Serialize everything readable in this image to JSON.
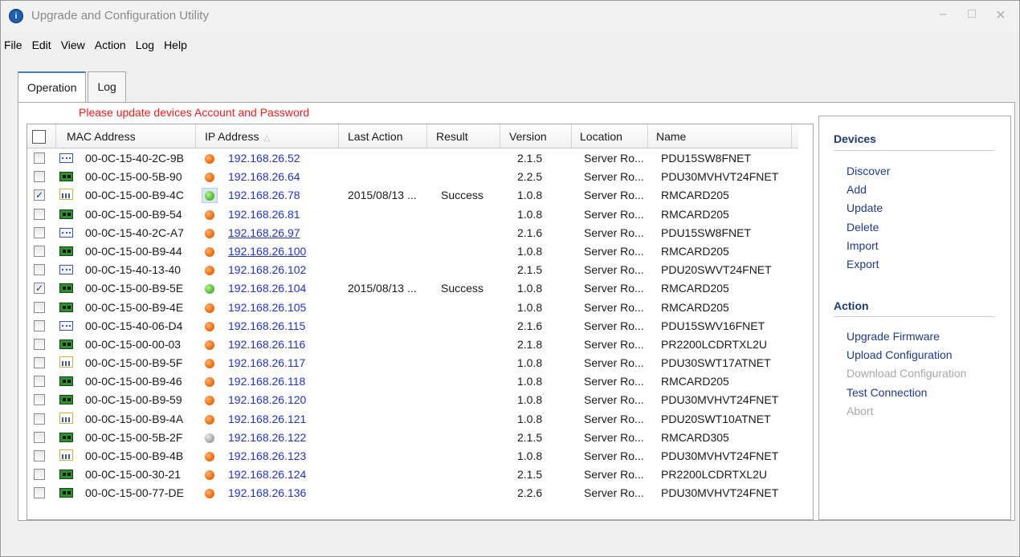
{
  "window": {
    "title": "Upgrade and Configuration Utility",
    "icon_name": "app-info-icon",
    "controls": [
      "minimize-icon",
      "maximize-icon",
      "close-icon"
    ]
  },
  "menu": [
    "File",
    "Edit",
    "View",
    "Action",
    "Log",
    "Help"
  ],
  "tabs": [
    {
      "label": "Operation",
      "active": true
    },
    {
      "label": "Log",
      "active": false
    }
  ],
  "warning": "Please update devices Account and Password",
  "table": {
    "columns": [
      "MAC Address",
      "IP Address",
      "Last Action",
      "Result",
      "Version",
      "Location",
      "Name"
    ],
    "sorted_column": "IP Address",
    "rows": [
      {
        "checked": false,
        "icon": "strip",
        "mac": "00-0C-15-40-2C-9B",
        "status": "orange",
        "ip": "192.168.26.52",
        "last_action": "",
        "result": "",
        "version": "2.1.5",
        "location": "Server Ro...",
        "name": "PDU15SW8FNET"
      },
      {
        "checked": false,
        "icon": "card",
        "mac": "00-0C-15-00-5B-90",
        "status": "orange",
        "ip": "192.168.26.64",
        "last_action": "",
        "result": "",
        "version": "2.2.5",
        "location": "Server Ro...",
        "name": "PDU30MVHVT24FNET"
      },
      {
        "checked": true,
        "icon": "ats",
        "mac": "00-0C-15-00-B9-4C",
        "status": "green",
        "selected": true,
        "ip": "192.168.26.78",
        "last_action": "2015/08/13 ...",
        "result": "Success",
        "version": "1.0.8",
        "location": "Server Ro...",
        "name": "RMCARD205"
      },
      {
        "checked": false,
        "icon": "card",
        "mac": "00-0C-15-00-B9-54",
        "status": "orange",
        "ip": "192.168.26.81",
        "last_action": "",
        "result": "",
        "version": "1.0.8",
        "location": "Server Ro...",
        "name": "RMCARD205"
      },
      {
        "checked": false,
        "icon": "strip",
        "mac": "00-0C-15-40-2C-A7",
        "status": "orange",
        "ip": "192.168.26.97",
        "link": true,
        "last_action": "",
        "result": "",
        "version": "2.1.6",
        "location": "Server Ro...",
        "name": "PDU15SW8FNET"
      },
      {
        "checked": false,
        "icon": "card",
        "mac": "00-0C-15-00-B9-44",
        "status": "orange",
        "ip": "192.168.26.100",
        "link": true,
        "last_action": "",
        "result": "",
        "version": "1.0.8",
        "location": "Server Ro...",
        "name": "RMCARD205"
      },
      {
        "checked": false,
        "icon": "strip",
        "mac": "00-0C-15-40-13-40",
        "status": "orange",
        "ip": "192.168.26.102",
        "last_action": "",
        "result": "",
        "version": "2.1.5",
        "location": "Server Ro...",
        "name": "PDU20SWVT24FNET"
      },
      {
        "checked": true,
        "icon": "card",
        "mac": "00-0C-15-00-B9-5E",
        "status": "green",
        "ip": "192.168.26.104",
        "last_action": "2015/08/13 ...",
        "result": "Success",
        "version": "1.0.8",
        "location": "Server Ro...",
        "name": "RMCARD205"
      },
      {
        "checked": false,
        "icon": "card",
        "mac": "00-0C-15-00-B9-4E",
        "status": "orange",
        "ip": "192.168.26.105",
        "last_action": "",
        "result": "",
        "version": "1.0.8",
        "location": "Server Ro...",
        "name": "RMCARD205"
      },
      {
        "checked": false,
        "icon": "strip",
        "mac": "00-0C-15-40-06-D4",
        "status": "orange",
        "ip": "192.168.26.115",
        "last_action": "",
        "result": "",
        "version": "2.1.6",
        "location": "Server Ro...",
        "name": "PDU15SWV16FNET"
      },
      {
        "checked": false,
        "icon": "card",
        "mac": "00-0C-15-00-00-03",
        "status": "orange",
        "ip": "192.168.26.116",
        "last_action": "",
        "result": "",
        "version": "2.1.8",
        "location": "Server Ro...",
        "name": "PR2200LCDRTXL2U"
      },
      {
        "checked": false,
        "icon": "ats",
        "mac": "00-0C-15-00-B9-5F",
        "status": "orange",
        "ip": "192.168.26.117",
        "last_action": "",
        "result": "",
        "version": "1.0.8",
        "location": "Server Ro...",
        "name": "PDU30SWT17ATNET"
      },
      {
        "checked": false,
        "icon": "card",
        "mac": "00-0C-15-00-B9-46",
        "status": "orange",
        "ip": "192.168.26.118",
        "last_action": "",
        "result": "",
        "version": "1.0.8",
        "location": "Server Ro...",
        "name": "RMCARD205"
      },
      {
        "checked": false,
        "icon": "card",
        "mac": "00-0C-15-00-B9-59",
        "status": "orange",
        "ip": "192.168.26.120",
        "last_action": "",
        "result": "",
        "version": "1.0.8",
        "location": "Server Ro...",
        "name": "PDU30MVHVT24FNET"
      },
      {
        "checked": false,
        "icon": "ats",
        "mac": "00-0C-15-00-B9-4A",
        "status": "orange",
        "ip": "192.168.26.121",
        "last_action": "",
        "result": "",
        "version": "1.0.8",
        "location": "Server Ro...",
        "name": "PDU20SWT10ATNET"
      },
      {
        "checked": false,
        "icon": "card",
        "mac": "00-0C-15-00-5B-2F",
        "status": "gray",
        "ip": "192.168.26.122",
        "last_action": "",
        "result": "",
        "version": "2.1.5",
        "location": "Server Ro...",
        "name": "RMCARD305"
      },
      {
        "checked": false,
        "icon": "ats",
        "mac": "00-0C-15-00-B9-4B",
        "status": "orange",
        "ip": "192.168.26.123",
        "last_action": "",
        "result": "",
        "version": "1.0.8",
        "location": "Server Ro...",
        "name": "PDU30MVHVT24FNET"
      },
      {
        "checked": false,
        "icon": "card",
        "mac": "00-0C-15-00-30-21",
        "status": "orange",
        "ip": "192.168.26.124",
        "last_action": "",
        "result": "",
        "version": "2.1.5",
        "location": "Server Ro...",
        "name": "PR2200LCDRTXL2U"
      },
      {
        "checked": false,
        "icon": "card",
        "mac": "00-0C-15-00-77-DE",
        "status": "orange",
        "ip": "192.168.26.136",
        "last_action": "",
        "result": "",
        "version": "2.2.6",
        "location": "Server Ro...",
        "name": "PDU30MVHVT24FNET"
      }
    ]
  },
  "sidebar": {
    "devices_title": "Devices",
    "devices": [
      {
        "label": "Discover",
        "enabled": true
      },
      {
        "label": "Add",
        "enabled": true
      },
      {
        "label": "Update",
        "enabled": true
      },
      {
        "label": "Delete",
        "enabled": true
      },
      {
        "label": "Import",
        "enabled": true
      },
      {
        "label": "Export",
        "enabled": true
      }
    ],
    "action_title": "Action",
    "actions": [
      {
        "label": "Upgrade Firmware",
        "enabled": true
      },
      {
        "label": "Upload Configuration",
        "enabled": true
      },
      {
        "label": "Download Configuration",
        "enabled": false
      },
      {
        "label": "Test Connection",
        "enabled": true
      },
      {
        "label": "Abort",
        "enabled": false
      }
    ]
  },
  "colors": {
    "warning": "#ff1a1a",
    "link": "#2233cc",
    "side_link": "#1e3a8a",
    "disabled": "#a8a8a8",
    "status_orange": "#f07010",
    "status_green": "#55c030",
    "status_gray": "#a8a8a8"
  }
}
